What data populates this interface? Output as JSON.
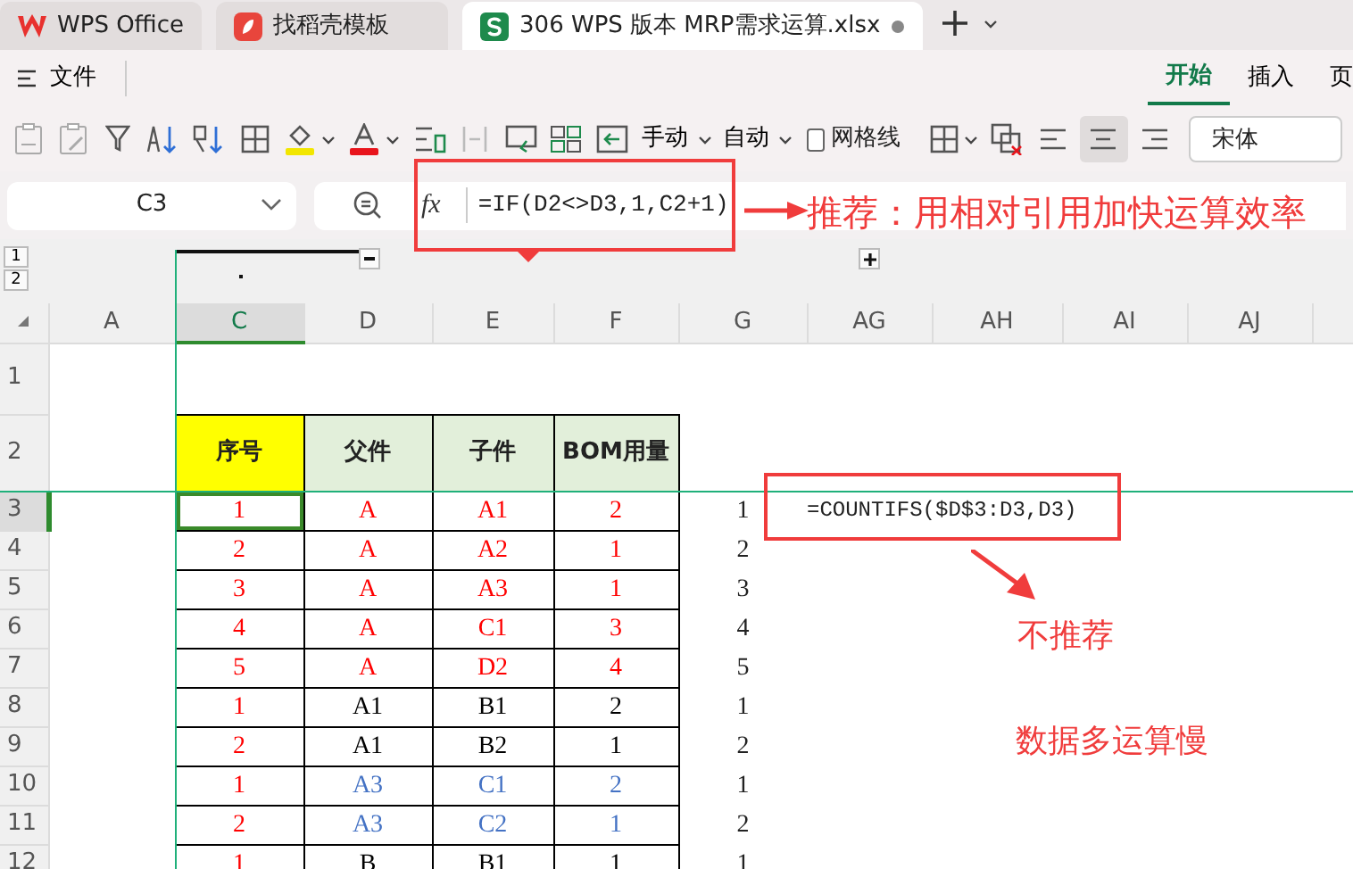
{
  "tabs": [
    {
      "label": "WPS Office",
      "kind": "home",
      "selected": false
    },
    {
      "label": "找稻壳模板",
      "kind": "template",
      "selected": false
    },
    {
      "label": "306 WPS 版本 MRP需求运算.xlsx",
      "kind": "sheet",
      "selected": true
    }
  ],
  "menu": {
    "file": "文件",
    "tabs": [
      {
        "label": "开始",
        "selected": true
      },
      {
        "label": "插入",
        "selected": false
      },
      {
        "label": "页",
        "selected": false
      }
    ]
  },
  "toolbar": {
    "dropdowns": [
      "手动",
      "自动"
    ],
    "gridlines": {
      "label": "网格线",
      "checked": false
    },
    "font": "宋体"
  },
  "formula_bar": {
    "cell": "C3",
    "fx": "fx",
    "formula": "=IF(D2<>D3,1,C2+1)"
  },
  "outline": {
    "levels": [
      "1",
      "2"
    ]
  },
  "columns": [
    {
      "label": "A",
      "selected": false
    },
    {
      "label": "C",
      "selected": true
    },
    {
      "label": "D",
      "selected": false
    },
    {
      "label": "E",
      "selected": false
    },
    {
      "label": "F",
      "selected": false
    },
    {
      "label": "G",
      "selected": false
    },
    {
      "label": "AG",
      "selected": false
    },
    {
      "label": "AH",
      "selected": false
    },
    {
      "label": "AI",
      "selected": false
    },
    {
      "label": "AJ",
      "selected": false
    }
  ],
  "row_numbers": [
    {
      "label": "1",
      "selected": false
    },
    {
      "label": "2",
      "selected": false
    },
    {
      "label": "3",
      "selected": true
    },
    {
      "label": "4",
      "selected": false
    },
    {
      "label": "5",
      "selected": false
    },
    {
      "label": "6",
      "selected": false
    },
    {
      "label": "7",
      "selected": false
    },
    {
      "label": "8",
      "selected": false
    },
    {
      "label": "9",
      "selected": false
    },
    {
      "label": "10",
      "selected": false
    },
    {
      "label": "11",
      "selected": false
    },
    {
      "label": "12",
      "selected": false
    }
  ],
  "header": [
    {
      "text": "序号",
      "color": "#ffff00"
    },
    {
      "text": "父件",
      "color": "#e2efda"
    },
    {
      "text": "子件",
      "color": "#e2efda"
    },
    {
      "text": "BOM用量",
      "color": "#e2efda"
    }
  ],
  "rows": [
    {
      "cells": [
        {
          "text": "1",
          "color": "#ff0000",
          "selected": true
        },
        {
          "text": "A",
          "color": "#ff0000",
          "selected": false
        },
        {
          "text": "A1",
          "color": "#ff0000",
          "selected": false
        },
        {
          "text": "2",
          "color": "#ff0000",
          "selected": false
        }
      ],
      "count": "1",
      "note": "=COUNTIFS($D$3:D3,D3)"
    },
    {
      "cells": [
        {
          "text": "2",
          "color": "#ff0000",
          "selected": false
        },
        {
          "text": "A",
          "color": "#ff0000",
          "selected": false
        },
        {
          "text": "A2",
          "color": "#ff0000",
          "selected": false
        },
        {
          "text": "1",
          "color": "#ff0000",
          "selected": false
        }
      ],
      "count": "2"
    },
    {
      "cells": [
        {
          "text": "3",
          "color": "#ff0000",
          "selected": false
        },
        {
          "text": "A",
          "color": "#ff0000",
          "selected": false
        },
        {
          "text": "A3",
          "color": "#ff0000",
          "selected": false
        },
        {
          "text": "1",
          "color": "#ff0000",
          "selected": false
        }
      ],
      "count": "3"
    },
    {
      "cells": [
        {
          "text": "4",
          "color": "#ff0000",
          "selected": false
        },
        {
          "text": "A",
          "color": "#ff0000",
          "selected": false
        },
        {
          "text": "C1",
          "color": "#ff0000",
          "selected": false
        },
        {
          "text": "3",
          "color": "#ff0000",
          "selected": false
        }
      ],
      "count": "4"
    },
    {
      "cells": [
        {
          "text": "5",
          "color": "#ff0000",
          "selected": false
        },
        {
          "text": "A",
          "color": "#ff0000",
          "selected": false
        },
        {
          "text": "D2",
          "color": "#ff0000",
          "selected": false
        },
        {
          "text": "4",
          "color": "#ff0000",
          "selected": false
        }
      ],
      "count": "5"
    },
    {
      "cells": [
        {
          "text": "1",
          "color": "#ff0000",
          "selected": false
        },
        {
          "text": "A1",
          "color": "#000000",
          "selected": false
        },
        {
          "text": "B1",
          "color": "#000000",
          "selected": false
        },
        {
          "text": "2",
          "color": "#000000",
          "selected": false
        }
      ],
      "count": "1"
    },
    {
      "cells": [
        {
          "text": "2",
          "color": "#ff0000",
          "selected": false
        },
        {
          "text": "A1",
          "color": "#000000",
          "selected": false
        },
        {
          "text": "B2",
          "color": "#000000",
          "selected": false
        },
        {
          "text": "1",
          "color": "#000000",
          "selected": false
        }
      ],
      "count": "2"
    },
    {
      "cells": [
        {
          "text": "1",
          "color": "#ff0000",
          "selected": false
        },
        {
          "text": "A3",
          "color": "#4472c4",
          "selected": false
        },
        {
          "text": "C1",
          "color": "#4472c4",
          "selected": false
        },
        {
          "text": "2",
          "color": "#4472c4",
          "selected": false
        }
      ],
      "count": "1"
    },
    {
      "cells": [
        {
          "text": "2",
          "color": "#ff0000",
          "selected": false
        },
        {
          "text": "A3",
          "color": "#4472c4",
          "selected": false
        },
        {
          "text": "C2",
          "color": "#4472c4",
          "selected": false
        },
        {
          "text": "1",
          "color": "#4472c4",
          "selected": false
        }
      ],
      "count": "2"
    },
    {
      "cells": [
        {
          "text": "1",
          "color": "#ff0000",
          "selected": false
        },
        {
          "text": "B",
          "color": "#000000",
          "selected": false
        },
        {
          "text": "B1",
          "color": "#000000",
          "selected": false
        },
        {
          "text": "1",
          "color": "#000000",
          "selected": false
        }
      ],
      "count": "1"
    }
  ],
  "annotations": {
    "recommend": "推荐：用相对引用加快运算效率",
    "not_recommended": "不推荐",
    "reason": "数据多运算慢"
  }
}
